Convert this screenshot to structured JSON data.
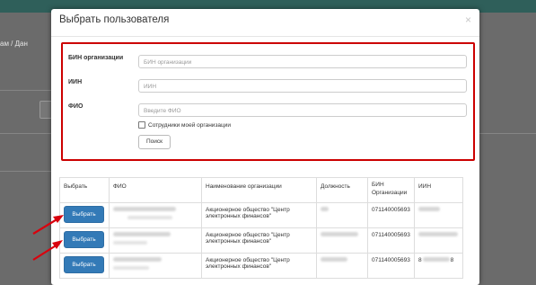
{
  "background": {
    "breadcrumb": "ам / Дан"
  },
  "modal": {
    "title": "Выбрать пользователя",
    "close_label": "×"
  },
  "form": {
    "bin_label": "БИН организации",
    "bin_placeholder": "БИН организации",
    "iin_label": "ИИН",
    "iin_placeholder": "ИИН",
    "fio_label": "ФИО",
    "fio_placeholder": "Введите ФИО",
    "employees_checkbox_label": "Сотрудники моей организации",
    "search_button": "Поиск"
  },
  "table": {
    "headers": [
      "Выбрать",
      "ФИО",
      "Наименование организации",
      "Должность",
      "БИН Организации",
      "ИИН"
    ],
    "rows": [
      {
        "button": "Выбрать",
        "org_line1": "Акционерное общество \"Центр",
        "org_line2": "электронных финансов\"",
        "bin": "071140005693",
        "iin": ""
      },
      {
        "button": "Выбрать",
        "org_line1": "Акционерное общество \"Центр",
        "org_line2": "электронных финансов\"",
        "bin": "071140005693",
        "iin": ""
      },
      {
        "button": "Выбрать",
        "org_line1": "Акционерное общество \"Центр",
        "org_line2": "электронных финансов\"",
        "bin": "071140005693",
        "iin_start": "8",
        "iin_end": "8"
      }
    ]
  },
  "colors": {
    "highlight_border": "#cc0000",
    "primary_button": "#337ab7",
    "arrow": "#d9000d"
  }
}
